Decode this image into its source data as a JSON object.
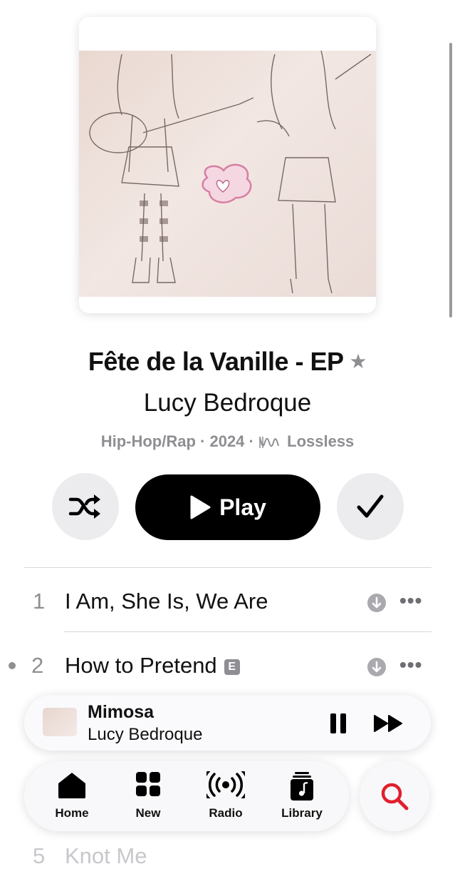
{
  "album": {
    "title": "Fête de la Vanille - EP",
    "artist": "Lucy Bedroque",
    "genre": "Hip-Hop/Rap",
    "year": "2024",
    "quality": "Lossless",
    "favorite_icon": "star-icon"
  },
  "actions": {
    "shuffle_icon": "shuffle-icon",
    "play_label": "Play",
    "added_icon": "checkmark-icon"
  },
  "tracks": [
    {
      "number": "1",
      "title": "I Am, She Is, We Are",
      "explicit": false,
      "playing": false
    },
    {
      "number": "2",
      "title": "How to Pretend",
      "explicit": true,
      "explicit_label": "E",
      "playing": true
    },
    {
      "number": "5",
      "title": "Knot Me"
    }
  ],
  "now_playing": {
    "title": "Mimosa",
    "artist": "Lucy Bedroque"
  },
  "tabs": [
    {
      "label": "Home",
      "icon": "home-icon",
      "active": true
    },
    {
      "label": "New",
      "icon": "grid-icon"
    },
    {
      "label": "Radio",
      "icon": "radio-icon"
    },
    {
      "label": "Library",
      "icon": "library-icon"
    }
  ],
  "colors": {
    "accent": "#e0202e",
    "secondary_text": "#8e8e93"
  }
}
